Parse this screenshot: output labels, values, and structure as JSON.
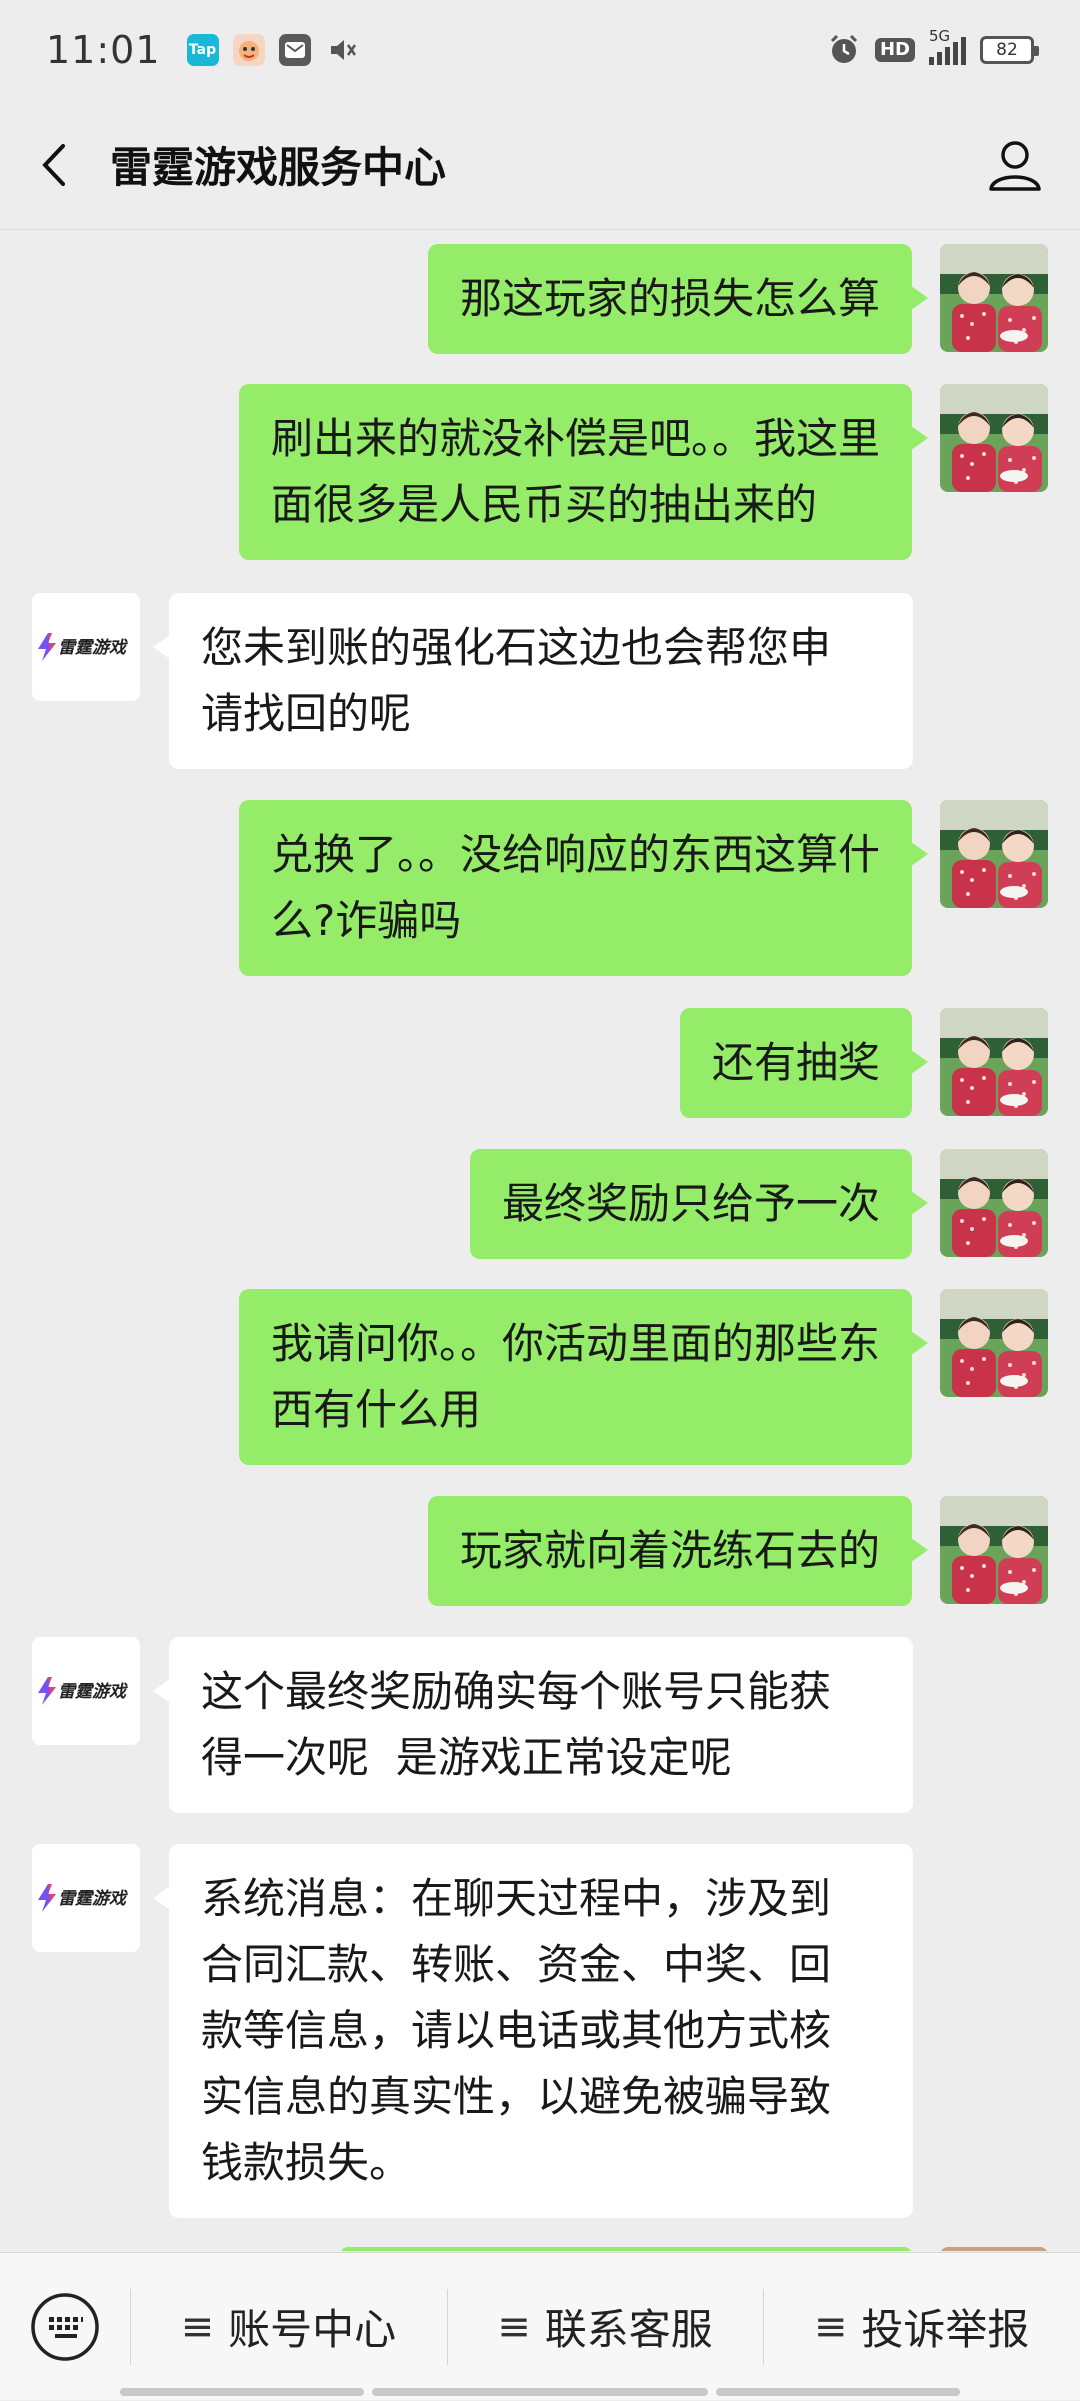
{
  "status_bar": {
    "time": "11:01",
    "apps": [
      "Tap",
      "mascot-app",
      "message-app"
    ],
    "hd_label": "HD",
    "network_label": "5G",
    "battery_level": "82"
  },
  "header": {
    "title": "雷霆游戏服务中心",
    "back_icon": "chevron-left-icon",
    "profile_icon": "person-icon"
  },
  "colors": {
    "background": "#ededed",
    "outgoing_bubble": "#95ec69",
    "incoming_bubble": "#ffffff",
    "brand_accent": "#7b4ff2"
  },
  "bot_logo_text": "雷霆游戏",
  "messages": [
    {
      "sender": "user",
      "text": "那这玩家的损失怎么算"
    },
    {
      "sender": "user",
      "text": "刷出来的就没补偿是吧。。我这里\n面很多是人民币买的抽出来的"
    },
    {
      "sender": "service",
      "text": "您未到账的强化石这边也会帮您申\n请找回的呢"
    },
    {
      "sender": "user",
      "text": "兑换了。。没给响应的东西这算什\n么?诈骗吗"
    },
    {
      "sender": "user",
      "text": "还有抽奖"
    },
    {
      "sender": "user",
      "text": "最终奖励只给予一次"
    },
    {
      "sender": "user",
      "text": "我请问你。。你活动里面的那些东\n西有什么用"
    },
    {
      "sender": "user",
      "text": "玩家就向着洗练石去的"
    },
    {
      "sender": "service",
      "text": "这个最终奖励确实每个账号只能获\n得一次呢  是游戏正常设定呢"
    },
    {
      "sender": "service",
      "text": "系统消息：在聊天过程中，涉及到\n合同汇款、转账、资金、中奖、回\n款等信息，请以电话或其他方式核\n实信息的真实性，以避免被骗导致\n钱款损失。"
    }
  ],
  "bottom_menu": {
    "keyboard_icon": "keyboard-icon",
    "items": [
      {
        "prefix": "≡",
        "label": "账号中心"
      },
      {
        "prefix": "≡",
        "label": "联系客服"
      },
      {
        "prefix": "≡",
        "label": "投诉举报"
      }
    ]
  }
}
